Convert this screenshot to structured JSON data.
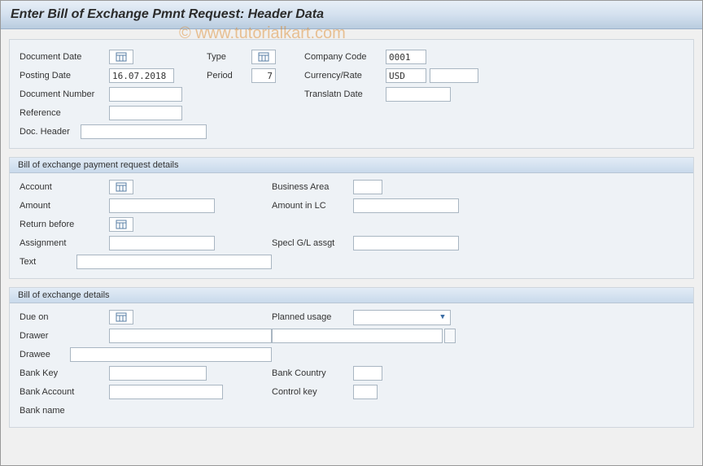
{
  "title": "Enter Bill of Exchange Pmnt Request: Header Data",
  "watermark": "© www.tutorialkart.com",
  "top": {
    "documentDate": {
      "label": "Document Date",
      "value": ""
    },
    "postingDate": {
      "label": "Posting Date",
      "value": "16.07.2018"
    },
    "documentNumber": {
      "label": "Document Number",
      "value": ""
    },
    "reference": {
      "label": "Reference",
      "value": ""
    },
    "docHeader": {
      "label": "Doc. Header",
      "value": ""
    },
    "type": {
      "label": "Type",
      "value": ""
    },
    "period": {
      "label": "Period",
      "value": "7"
    },
    "companyCode": {
      "label": "Company Code",
      "value": "0001"
    },
    "currencyRate": {
      "label": "Currency/Rate",
      "value": "USD",
      "value2": ""
    },
    "translatnDate": {
      "label": "Translatn Date",
      "value": ""
    }
  },
  "group1": {
    "title": "Bill of exchange payment request details",
    "account": {
      "label": "Account",
      "value": ""
    },
    "amount": {
      "label": "Amount",
      "value": ""
    },
    "returnBefore": {
      "label": "Return before",
      "value": ""
    },
    "assignment": {
      "label": "Assignment",
      "value": ""
    },
    "text": {
      "label": "Text",
      "value": ""
    },
    "businessArea": {
      "label": "Business Area",
      "value": ""
    },
    "amountLC": {
      "label": "Amount in LC",
      "value": ""
    },
    "speclGL": {
      "label": "Specl G/L assgt",
      "value": ""
    }
  },
  "group2": {
    "title": "Bill of exchange details",
    "dueOn": {
      "label": "Due on",
      "value": ""
    },
    "drawer": {
      "label": "Drawer",
      "value": "",
      "value2": ""
    },
    "drawee": {
      "label": "Drawee",
      "value": ""
    },
    "bankKey": {
      "label": "Bank Key",
      "value": ""
    },
    "bankAccount": {
      "label": "Bank Account",
      "value": ""
    },
    "bankName": {
      "label": "Bank name",
      "value": ""
    },
    "plannedUsage": {
      "label": "Planned usage",
      "value": ""
    },
    "bankCountry": {
      "label": "Bank Country",
      "value": ""
    },
    "controlKey": {
      "label": "Control key",
      "value": ""
    }
  }
}
